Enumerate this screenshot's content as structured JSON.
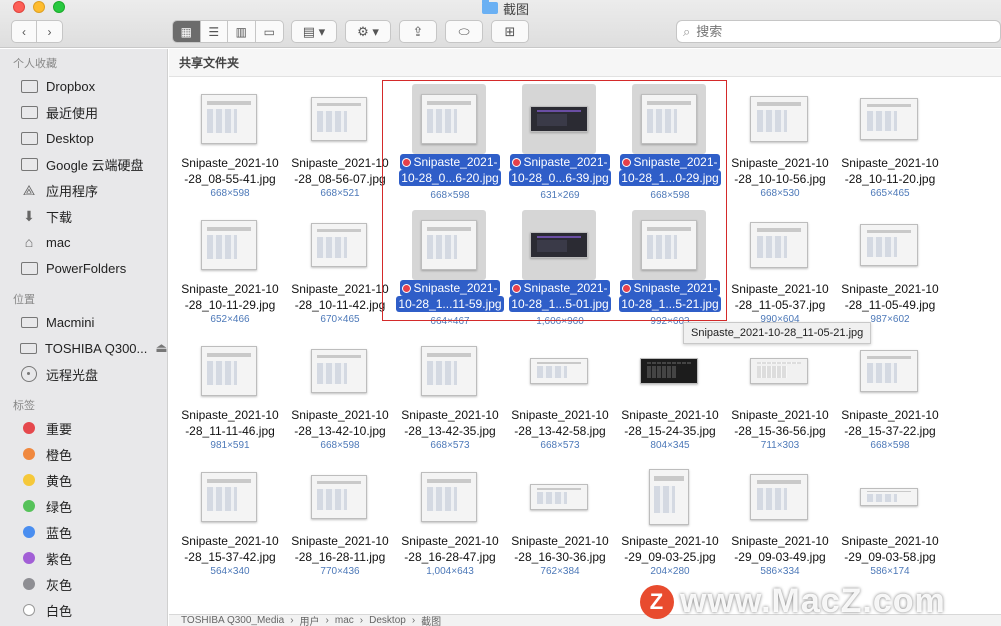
{
  "window": {
    "title": "截图",
    "search_placeholder": "搜索",
    "view_icons": [
      "icon-view-icon",
      "list-view-icon",
      "column-view-icon",
      "gallery-view-icon"
    ]
  },
  "sidebar": {
    "favorites_title": "个人收藏",
    "favorites": [
      {
        "label": "Dropbox",
        "icon": "folder-icon"
      },
      {
        "label": "最近使用",
        "icon": "recents-icon"
      },
      {
        "label": "Desktop",
        "icon": "folder-icon"
      },
      {
        "label": "Google 云端硬盘",
        "icon": "folder-icon"
      },
      {
        "label": "应用程序",
        "icon": "applications-icon"
      },
      {
        "label": "下载",
        "icon": "downloads-icon"
      },
      {
        "label": "mac",
        "icon": "home-icon"
      },
      {
        "label": "PowerFolders",
        "icon": "folder-icon"
      }
    ],
    "locations_title": "位置",
    "locations": [
      {
        "label": "Macmini",
        "icon": "computer-icon"
      },
      {
        "label": "TOSHIBA Q300...",
        "icon": "disk-icon"
      },
      {
        "label": "远程光盘",
        "icon": "disc-icon"
      }
    ],
    "tags_title": "标签",
    "tags": [
      {
        "label": "重要",
        "color": "#e5484d"
      },
      {
        "label": "橙色",
        "color": "#f0883e"
      },
      {
        "label": "黄色",
        "color": "#f5c83a"
      },
      {
        "label": "绿色",
        "color": "#56c25a"
      },
      {
        "label": "蓝色",
        "color": "#4a8ef0"
      },
      {
        "label": "紫色",
        "color": "#a25fd6"
      },
      {
        "label": "灰色",
        "color": "#8e8e93"
      },
      {
        "label": "白色",
        "color": "#ffffff"
      }
    ]
  },
  "content": {
    "header": "共享文件夹",
    "tooltip": "Snipaste_2021-10-28_11-05-21.jpg",
    "files": [
      {
        "l1": "Snipaste_2021-10",
        "l2": "-28_08-55-41.jpg",
        "dims": "668×598",
        "sel": false
      },
      {
        "l1": "Snipaste_2021-10",
        "l2": "-28_08-56-07.jpg",
        "dims": "668×521",
        "sel": false
      },
      {
        "l1": "Snipaste_2021-",
        "l2": "10-28_0...6-20.jpg",
        "dims": "668×598",
        "sel": true
      },
      {
        "l1": "Snipaste_2021-",
        "l2": "10-28_0...6-39.jpg",
        "dims": "631×269",
        "sel": true
      },
      {
        "l1": "Snipaste_2021-",
        "l2": "10-28_1...0-29.jpg",
        "dims": "668×598",
        "sel": true
      },
      {
        "l1": "Snipaste_2021-10",
        "l2": "-28_10-10-56.jpg",
        "dims": "668×530",
        "sel": false
      },
      {
        "l1": "Snipaste_2021-10",
        "l2": "-28_10-11-20.jpg",
        "dims": "665×465",
        "sel": false
      },
      {
        "l1": "Snipaste_2021-10",
        "l2": "-28_10-11-29.jpg",
        "dims": "652×466",
        "sel": false
      },
      {
        "l1": "Snipaste_2021-10",
        "l2": "-28_10-11-42.jpg",
        "dims": "670×465",
        "sel": false
      },
      {
        "l1": "Snipaste_2021-",
        "l2": "10-28_1...11-59.jpg",
        "dims": "664×467",
        "sel": true
      },
      {
        "l1": "Snipaste_2021-",
        "l2": "10-28_1...5-01.jpg",
        "dims": "1,606×960",
        "sel": true
      },
      {
        "l1": "Snipaste_2021-",
        "l2": "10-28_1...5-21.jpg",
        "dims": "992×603",
        "sel": true
      },
      {
        "l1": "Snipaste_2021-10",
        "l2": "-28_11-05-37.jpg",
        "dims": "990×604",
        "sel": false
      },
      {
        "l1": "Snipaste_2021-10",
        "l2": "-28_11-05-49.jpg",
        "dims": "987×602",
        "sel": false
      },
      {
        "l1": "Snipaste_2021-10",
        "l2": "-28_11-11-46.jpg",
        "dims": "981×591",
        "sel": false
      },
      {
        "l1": "Snipaste_2021-10",
        "l2": "-28_13-42-10.jpg",
        "dims": "668×598",
        "sel": false
      },
      {
        "l1": "Snipaste_2021-10",
        "l2": "-28_13-42-35.jpg",
        "dims": "668×573",
        "sel": false
      },
      {
        "l1": "Snipaste_2021-10",
        "l2": "-28_13-42-58.jpg",
        "dims": "668×573",
        "sel": false
      },
      {
        "l1": "Snipaste_2021-10",
        "l2": "-28_15-24-35.jpg",
        "dims": "804×345",
        "sel": false
      },
      {
        "l1": "Snipaste_2021-10",
        "l2": "-28_15-36-56.jpg",
        "dims": "711×303",
        "sel": false
      },
      {
        "l1": "Snipaste_2021-10",
        "l2": "-28_15-37-22.jpg",
        "dims": "668×598",
        "sel": false
      },
      {
        "l1": "Snipaste_2021-10",
        "l2": "-28_15-37-42.jpg",
        "dims": "564×340",
        "sel": false
      },
      {
        "l1": "Snipaste_2021-10",
        "l2": "-28_16-28-11.jpg",
        "dims": "770×436",
        "sel": false
      },
      {
        "l1": "Snipaste_2021-10",
        "l2": "-28_16-28-47.jpg",
        "dims": "1,004×643",
        "sel": false
      },
      {
        "l1": "Snipaste_2021-10",
        "l2": "-28_16-30-36.jpg",
        "dims": "762×384",
        "sel": false
      },
      {
        "l1": "Snipaste_2021-10",
        "l2": "-29_09-03-25.jpg",
        "dims": "204×280",
        "sel": false
      },
      {
        "l1": "Snipaste_2021-10",
        "l2": "-29_09-03-49.jpg",
        "dims": "586×334",
        "sel": false
      },
      {
        "l1": "Snipaste_2021-10",
        "l2": "-29_09-03-58.jpg",
        "dims": "586×174",
        "sel": false
      }
    ]
  },
  "pathbar": [
    "TOSHIBA Q300_Media",
    "用户",
    "mac",
    "Desktop",
    "截图"
  ],
  "watermark": {
    "logo": "Z",
    "text": "www.MacZ.com"
  }
}
